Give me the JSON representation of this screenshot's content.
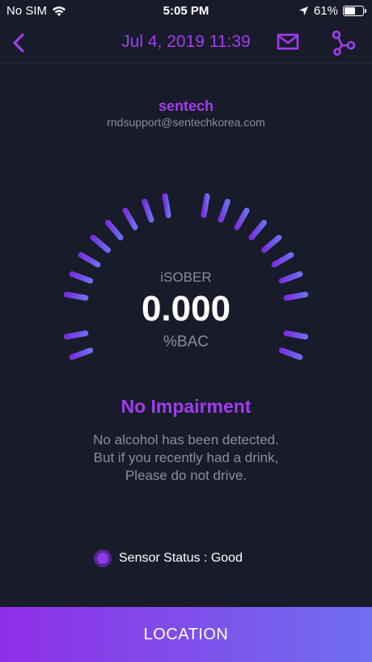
{
  "status_bar": {
    "carrier": "No SIM",
    "time": "5:05 PM",
    "battery": "61%",
    "battery_level": 0.61,
    "icons": [
      "wifi-icon",
      "location-arrow-icon",
      "battery-icon"
    ]
  },
  "nav": {
    "title": "Jul 4, 2019 11:39",
    "icons": [
      "chevron-left-icon",
      "mail-icon",
      "share-icon"
    ]
  },
  "account": {
    "name": "sentech",
    "email": "rndsupport@sentechkorea.com"
  },
  "gauge": {
    "brand": "iSOBER",
    "value": "0.000",
    "unit": "%BAC"
  },
  "result": {
    "title": "No Impairment",
    "message_lines": [
      "No alcohol has been detected.",
      "But if you recently had a drink,",
      "Please do not drive."
    ]
  },
  "sensor": {
    "label": "Sensor Status : Good"
  },
  "footer": {
    "button_label": "LOCATION"
  },
  "colors": {
    "background": "#181b29",
    "accent": "#a13cf0",
    "muted_text": "#8a8d9c",
    "gauge_start": "#7b2fe0",
    "gauge_end": "#6a6ef0"
  }
}
